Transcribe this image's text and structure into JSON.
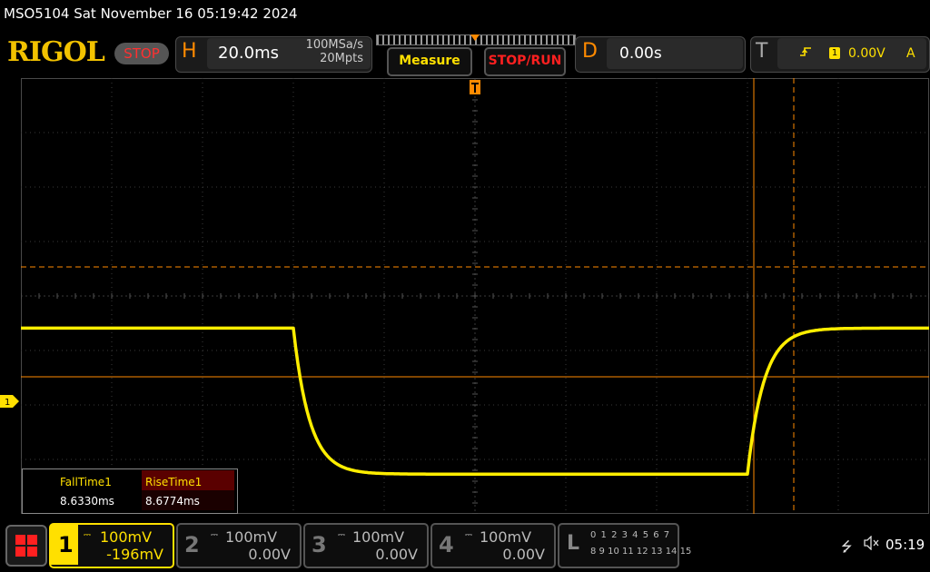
{
  "status": {
    "text": "MSO5104  Sat November 16 05:19:42 2024"
  },
  "header": {
    "logo": "RIGOL",
    "run_state": "STOP",
    "horizontal": {
      "letter": "H",
      "timebase": "20.0ms",
      "sample_rate": "100MSa/s",
      "memory_depth": "20Mpts"
    },
    "measure_label": "Measure",
    "stoprun_label": "STOP/RUN",
    "delay": {
      "letter": "D",
      "value": "0.00s"
    },
    "trigger": {
      "letter": "T",
      "edge_icon": "rising-edge-icon",
      "channel": "1",
      "level": "0.00V",
      "mode": "A"
    }
  },
  "waveform": {
    "channel_marker": "1",
    "trace_color": "#ffee00",
    "cursor_color": "#ff8a00",
    "high_level_mV": 137,
    "low_level_mV": -131,
    "fall_start_ms": -40,
    "rise_start_ms": 60
  },
  "measurements": [
    {
      "label": "FallTime1",
      "value": "8.6330ms"
    },
    {
      "label": "RiseTime1",
      "value": "8.6774ms"
    }
  ],
  "channels": [
    {
      "num": "1",
      "scale": "100mV",
      "offset": "-196mV",
      "active": true
    },
    {
      "num": "2",
      "scale": "100mV",
      "offset": "0.00V",
      "active": false
    },
    {
      "num": "3",
      "scale": "100mV",
      "offset": "0.00V",
      "active": false
    },
    {
      "num": "4",
      "scale": "100mV",
      "offset": "0.00V",
      "active": false
    }
  ],
  "logic": {
    "letter": "L",
    "row1": "0 1 2 3  4 5 6 7",
    "row2": "8 9 10 11 12 13 14 15"
  },
  "system": {
    "usb_icon": "usb-icon",
    "mute_icon": "speaker-mute-icon",
    "clock": "05:19"
  },
  "colors": {
    "accent": "#ff8a00",
    "ch1": "#ffee00",
    "stop": "#ff2020"
  }
}
